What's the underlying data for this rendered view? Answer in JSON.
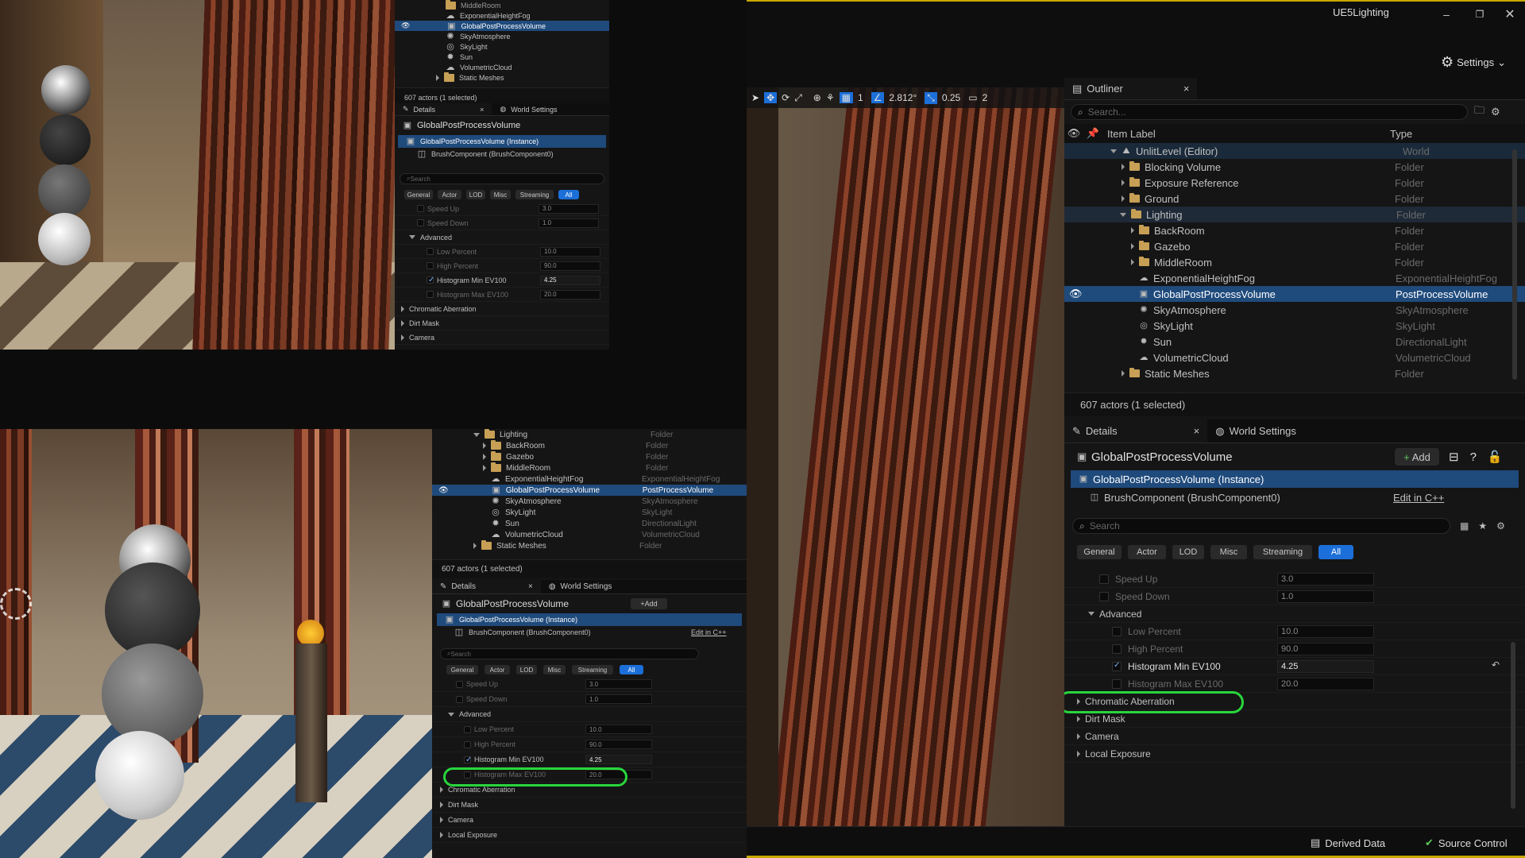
{
  "window": {
    "title": "UE5Lighting",
    "settings_label": "Settings"
  },
  "toolbar": {
    "angle": "2.812°",
    "scale": "0.25",
    "grid": "1",
    "camera_speed": "2"
  },
  "outliner": {
    "tab_title": "Outliner",
    "search_placeholder": "Search...",
    "col_label": "Item Label",
    "col_type": "Type",
    "rows": [
      {
        "label": "UnlitLevel (Editor)",
        "type": "World"
      },
      {
        "label": "Blocking Volume",
        "type": "Folder"
      },
      {
        "label": "Exposure Reference",
        "type": "Folder"
      },
      {
        "label": "Ground",
        "type": "Folder"
      },
      {
        "label": "Lighting",
        "type": "Folder"
      },
      {
        "label": "BackRoom",
        "type": "Folder"
      },
      {
        "label": "Gazebo",
        "type": "Folder"
      },
      {
        "label": "MiddleRoom",
        "type": "Folder"
      },
      {
        "label": "ExponentialHeightFog",
        "type": "ExponentialHeightFog"
      },
      {
        "label": "GlobalPostProcessVolume",
        "type": "PostProcessVolume"
      },
      {
        "label": "SkyAtmosphere",
        "type": "SkyAtmosphere"
      },
      {
        "label": "SkyLight",
        "type": "SkyLight"
      },
      {
        "label": "Sun",
        "type": "DirectionalLight"
      },
      {
        "label": "VolumetricCloud",
        "type": "VolumetricCloud"
      },
      {
        "label": "Static Meshes",
        "type": "Folder"
      }
    ],
    "status": "607 actors (1 selected)"
  },
  "details": {
    "tab_title": "Details",
    "world_settings": "World Settings",
    "actor_name": "GlobalPostProcessVolume",
    "add_label": "Add",
    "instance": "GlobalPostProcessVolume (Instance)",
    "component": "BrushComponent (BrushComponent0)",
    "edit_cpp": "Edit in C++",
    "search_placeholder": "Search",
    "filters": [
      "General",
      "Actor",
      "LOD",
      "Misc",
      "Streaming",
      "All"
    ],
    "props": [
      {
        "label": "Speed Up",
        "value": "3.0"
      },
      {
        "label": "Speed Down",
        "value": "1.0"
      }
    ],
    "advanced_label": "Advanced",
    "adv_props": [
      {
        "label": "Low Percent",
        "value": "10.0"
      },
      {
        "label": "High Percent",
        "value": "90.0"
      },
      {
        "label": "Histogram Min EV100",
        "value": "4.25"
      },
      {
        "label": "Histogram Max EV100",
        "value": "20.0"
      }
    ],
    "sections": [
      "Chromatic Aberration",
      "Dirt Mask",
      "Camera",
      "Local Exposure"
    ]
  },
  "statusbar": {
    "derived_data": "Derived Data",
    "source_control": "Source Control"
  },
  "colors": {
    "selection": "#1f4a7c",
    "accent": "#1c6fd8",
    "highlight": "#28d63c"
  }
}
